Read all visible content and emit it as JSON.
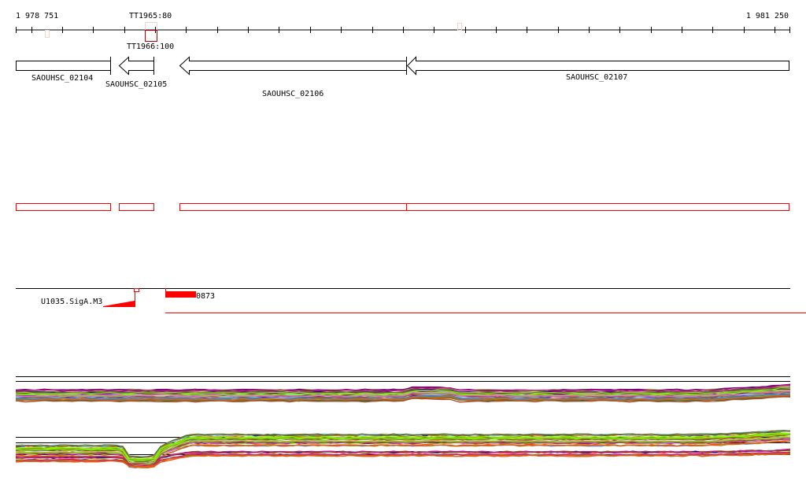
{
  "ruler": {
    "start_label": "1 978 751",
    "end_label": "1 981 250"
  },
  "markers": [
    {
      "label": "TT1965:80",
      "color": "#f6d2c8"
    },
    {
      "label": "TT1966:100",
      "color": "#b00000"
    }
  ],
  "genes": [
    {
      "name": "SAOUHSC_02104",
      "strand": "+"
    },
    {
      "name": "SAOUHSC_02105",
      "strand": "-"
    },
    {
      "name": "SAOUHSC_02106",
      "strand": "-"
    },
    {
      "name": "SAOUHSC_02107",
      "strand": "-"
    }
  ],
  "features": [
    {
      "label": "U1035.SigA.M3",
      "color": "#ff0000"
    },
    {
      "label": "0873",
      "color": "#ff0000"
    }
  ],
  "colors": {
    "axis": "#000000",
    "highlight": "#ff0000"
  }
}
